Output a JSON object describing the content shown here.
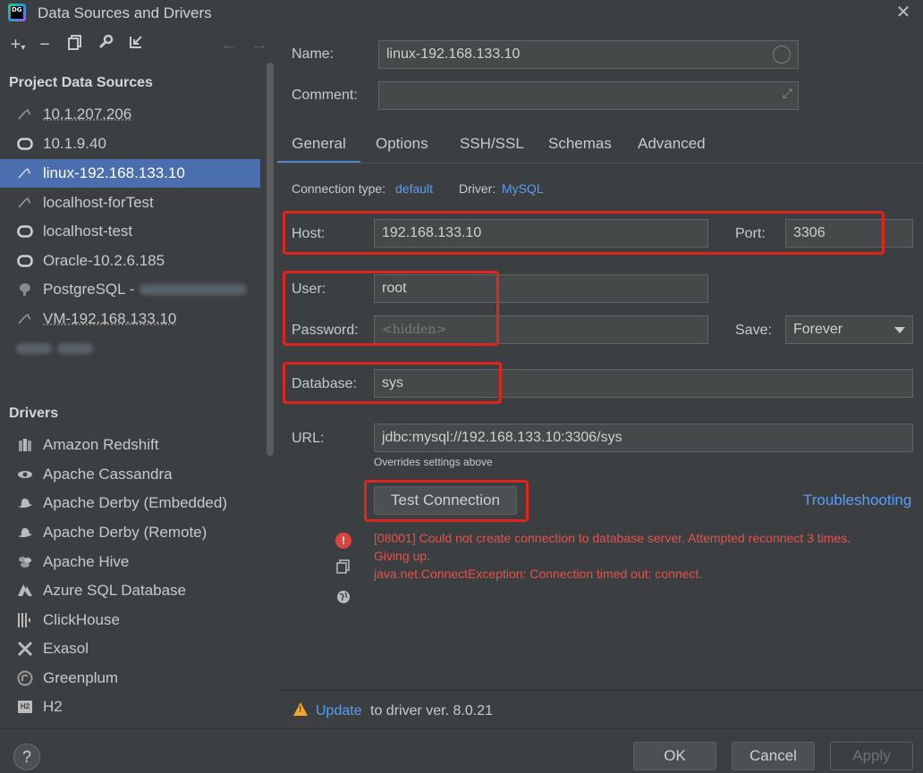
{
  "window": {
    "title": "Data Sources and Drivers",
    "app_icon_text": "DG"
  },
  "sidebar": {
    "project_title": "Project Data Sources",
    "data_sources": [
      {
        "label": "10.1.207.206",
        "icon": "mysql-dolphin-icon"
      },
      {
        "label": "10.1.9.40",
        "icon": "oracle-icon"
      },
      {
        "label": "linux-192.168.133.10",
        "icon": "mysql-dolphin-icon"
      },
      {
        "label": "localhost-forTest",
        "icon": "mysql-dolphin-icon"
      },
      {
        "label": "localhost-test",
        "icon": "oracle-icon"
      },
      {
        "label": "Oracle-10.2.6.185",
        "icon": "oracle-icon"
      },
      {
        "label": "PostgreSQL - ",
        "icon": "postgresql-elephant-icon"
      },
      {
        "label": "VM-192.168.133.10",
        "icon": "mysql-dolphin-icon"
      }
    ],
    "drivers_title": "Drivers",
    "drivers": [
      {
        "label": "Amazon Redshift",
        "icon": "redshift-icon"
      },
      {
        "label": "Apache Cassandra",
        "icon": "cassandra-eye-icon"
      },
      {
        "label": "Apache Derby (Embedded)",
        "icon": "derby-hat-icon"
      },
      {
        "label": "Apache Derby (Remote)",
        "icon": "derby-hat-icon"
      },
      {
        "label": "Apache Hive",
        "icon": "hive-bee-icon"
      },
      {
        "label": "Azure SQL Database",
        "icon": "azure-icon"
      },
      {
        "label": "ClickHouse",
        "icon": "clickhouse-bars-icon"
      },
      {
        "label": "Exasol",
        "icon": "exasol-x-icon"
      },
      {
        "label": "Greenplum",
        "icon": "greenplum-icon"
      },
      {
        "label": "H2",
        "icon": "h2-icon"
      }
    ]
  },
  "form": {
    "name_label": "Name:",
    "name_value": "linux-192.168.133.10",
    "comment_label": "Comment:",
    "comment_value": "",
    "tabs": [
      "General",
      "Options",
      "SSH/SSL",
      "Schemas",
      "Advanced"
    ],
    "conn_type_label": "Connection type:",
    "conn_type_value": "default",
    "driver_label": "Driver:",
    "driver_value": "MySQL",
    "host_label": "Host:",
    "host_value": "192.168.133.10",
    "port_label": "Port:",
    "port_value": "3306",
    "user_label": "User:",
    "user_value": "root",
    "password_label": "Password:",
    "password_placeholder": "<hidden>",
    "save_label": "Save:",
    "save_value": "Forever",
    "database_label": "Database:",
    "database_value": "sys",
    "url_label": "URL:",
    "url_value": "jdbc:mysql://192.168.133.10:3306/sys",
    "url_note": "Overrides settings above",
    "test_button": "Test Connection",
    "troubleshooting": "Troubleshooting",
    "error_line1": "[08001] Could not create connection to database server. Attempted reconnect 3 times.",
    "error_line2": "Giving up.",
    "error_line3": "java.net.ConnectException: Connection timed out: connect."
  },
  "update": {
    "link": "Update",
    "text": "to driver ver. 8.0.21"
  },
  "footer": {
    "ok": "OK",
    "cancel": "Cancel",
    "apply": "Apply",
    "help": "?"
  },
  "colors": {
    "accent": "#4b6eaf",
    "link": "#589df6",
    "error": "#e5514a",
    "highlight_box": "#e0261c",
    "warning": "#f0a732"
  }
}
